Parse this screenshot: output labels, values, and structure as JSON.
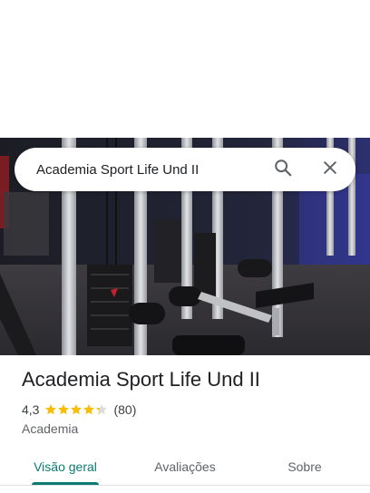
{
  "search": {
    "query": "Academia Sport Life Und II"
  },
  "place": {
    "name": "Academia Sport Life Und II",
    "rating": "4,3",
    "stars_value": 4.3,
    "review_count": "(80)",
    "category": "Academia"
  },
  "tabs": [
    {
      "label": "Visão geral",
      "active": true
    },
    {
      "label": "Avaliações",
      "active": false
    },
    {
      "label": "Sobre",
      "active": false
    }
  ],
  "colors": {
    "accent": "#0b7a75",
    "star": "#fbbc04",
    "star_empty": "#dadce0"
  },
  "icons": {
    "search": "search-icon",
    "close": "close-icon",
    "star": "star-icon"
  }
}
